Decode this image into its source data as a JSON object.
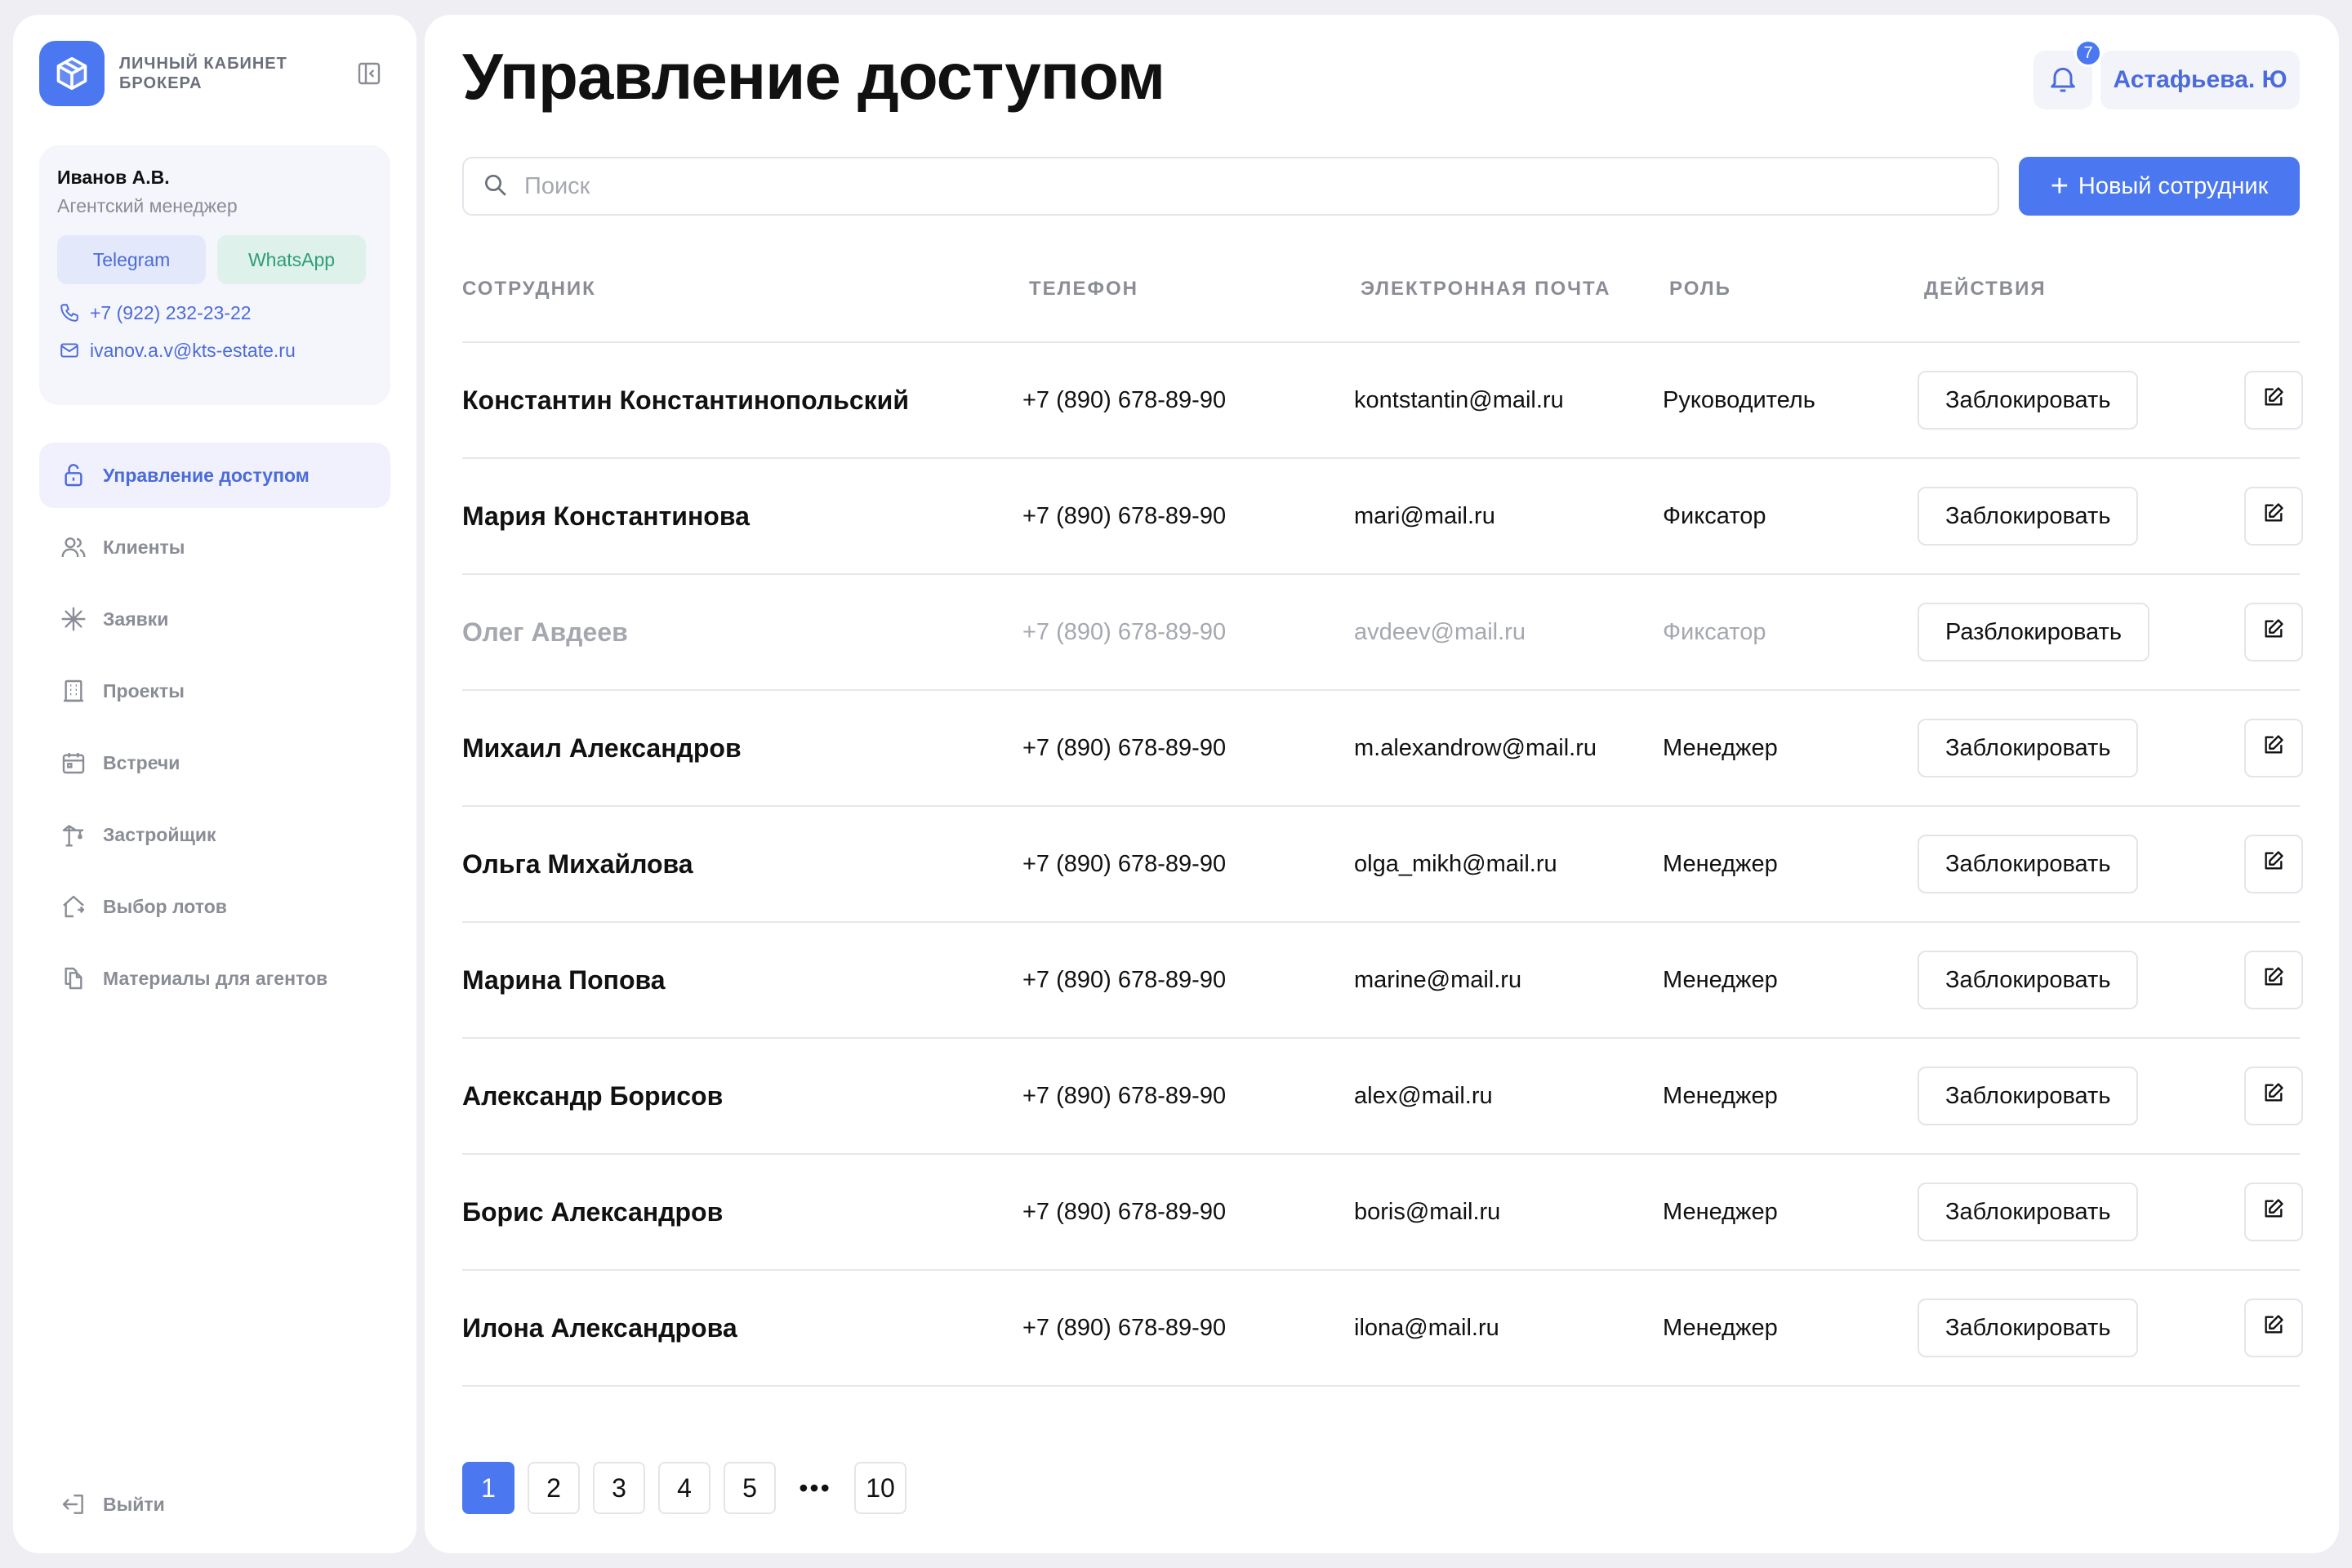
{
  "brand": {
    "title": "Личный кабинет брокера"
  },
  "manager": {
    "name": "Иванов А.В.",
    "role": "Агентский менеджер",
    "telegram_label": "Telegram",
    "whatsapp_label": "WhatsApp",
    "phone": "+7 (922) 232-23-22",
    "email": "ivanov.a.v@kts-estate.ru"
  },
  "nav": [
    {
      "label": "Управление доступом",
      "icon": "lock-icon",
      "active": true
    },
    {
      "label": "Клиенты",
      "icon": "users-icon"
    },
    {
      "label": "Заявки",
      "icon": "asterisk-icon"
    },
    {
      "label": "Проекты",
      "icon": "building-icon"
    },
    {
      "label": "Встречи",
      "icon": "calendar-icon"
    },
    {
      "label": "Застройщик",
      "icon": "crane-icon"
    },
    {
      "label": "Выбор лотов",
      "icon": "house-icon"
    },
    {
      "label": "Материалы для агентов",
      "icon": "files-icon"
    }
  ],
  "logout_label": "Выйти",
  "header": {
    "title": "Управление доступом",
    "notifications_count": "7",
    "user_name": "Астафьева. Ю"
  },
  "search": {
    "placeholder": "Поиск"
  },
  "new_button_label": "Новый сотрудник",
  "table": {
    "columns": [
      "Сотрудник",
      "Телефон",
      "Электронная почта",
      "Роль",
      "Действия"
    ],
    "rows": [
      {
        "name": "Константин Константинопольский",
        "phone": "+7 (890) 678-89-90",
        "email": "kontstantin@mail.ru",
        "role": "Руководитель",
        "action": "Заблокировать",
        "blocked": false
      },
      {
        "name": "Мария Константинова",
        "phone": "+7 (890) 678-89-90",
        "email": "mari@mail.ru",
        "role": "Фиксатор",
        "action": "Заблокировать",
        "blocked": false
      },
      {
        "name": "Олег Авдеев",
        "phone": "+7 (890) 678-89-90",
        "email": "avdeev@mail.ru",
        "role": "Фиксатор",
        "action": "Разблокировать",
        "blocked": true
      },
      {
        "name": "Михаил Александров",
        "phone": "+7 (890) 678-89-90",
        "email": "m.alexandrow@mail.ru",
        "role": "Менеджер",
        "action": "Заблокировать",
        "blocked": false
      },
      {
        "name": "Ольга Михайлова",
        "phone": "+7 (890) 678-89-90",
        "email": "olga_mikh@mail.ru",
        "role": "Менеджер",
        "action": "Заблокировать",
        "blocked": false
      },
      {
        "name": "Марина Попова",
        "phone": "+7 (890) 678-89-90",
        "email": "marine@mail.ru",
        "role": "Менеджер",
        "action": "Заблокировать",
        "blocked": false
      },
      {
        "name": "Александр Борисов",
        "phone": "+7 (890) 678-89-90",
        "email": "alex@mail.ru",
        "role": "Менеджер",
        "action": "Заблокировать",
        "blocked": false
      },
      {
        "name": "Борис Александров",
        "phone": "+7 (890) 678-89-90",
        "email": "boris@mail.ru",
        "role": "Менеджер",
        "action": "Заблокировать",
        "blocked": false
      },
      {
        "name": "Илона Александрова",
        "phone": "+7 (890) 678-89-90",
        "email": "ilona@mail.ru",
        "role": "Менеджер",
        "action": "Заблокировать",
        "blocked": false
      }
    ]
  },
  "pagination": {
    "pages": [
      "1",
      "2",
      "3",
      "4",
      "5",
      "10"
    ],
    "ellipsis": "•••",
    "current": "1"
  },
  "colors": {
    "accent": "#4B78F0",
    "muted": "#8A8D96",
    "border": "#E4E5EA"
  }
}
